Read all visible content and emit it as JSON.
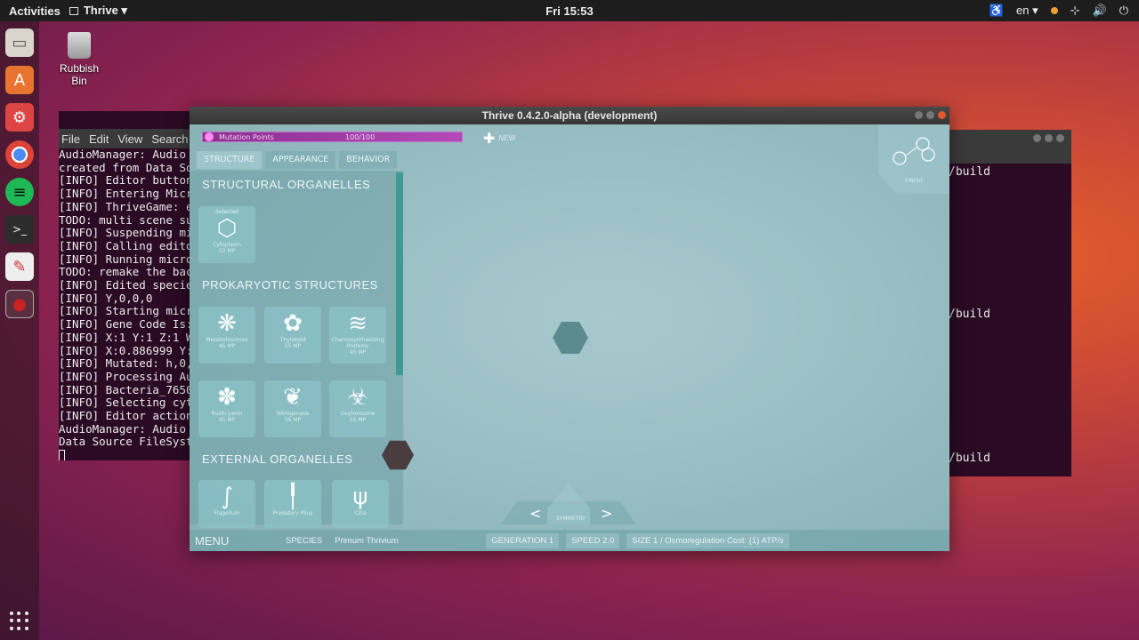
{
  "topbar": {
    "activities": "Activities",
    "app_name": "Thrive ▾",
    "clock": "Fri 15:53",
    "lang": "en ▾"
  },
  "desktop": {
    "bin_label": "Rubbish Bin"
  },
  "terminal_left": {
    "menu": [
      "File",
      "Edit",
      "View",
      "Search",
      "T"
    ],
    "lines": [
      "AudioManager: Audio",
      "created from Data So",
      "[INFO] Editor button",
      "[INFO] Entering Micr",
      "[INFO] ThriveGame: e",
      "TODO: multi scene su",
      "[INFO] Suspending mi",
      "[INFO] Calling edito",
      "[INFO] Running micro",
      "TODO: remake the bac",
      "[INFO] Edited specie",
      "[INFO] Y,0,0,0",
      "[INFO] Starting micr",
      "[INFO] Gene Code Is:",
      "[INFO] X:1 Y:1 Z:1 W",
      "[INFO] X:0.886999 Y:",
      "[INFO] Mutated: h,0,",
      "[INFO] Processing Au",
      "[INFO] Bacteria_7650",
      "[INFO] Selecting cyt",
      "[INFO] Editor action",
      "AudioManager: Audio",
      "Data Source FileSyst"
    ]
  },
  "terminal_right": {
    "lines": [
      "/build",
      "/build",
      "/build"
    ]
  },
  "thrive": {
    "title": "Thrive 0.4.2.0-alpha (development)",
    "mutation_points_label": "Mutation Points",
    "mutation_points_value": "100/100",
    "new_label": "NEW",
    "tabs": [
      "STRUCTURE",
      "APPEARANCE",
      "BEHAVIOR"
    ],
    "sections": [
      "STRUCTURAL ORGANELLES",
      "PROKARYOTIC STRUCTURES",
      "EXTERNAL ORGANELLES"
    ],
    "structural": [
      {
        "selected": "Selected",
        "name": "Cytoplasm",
        "cost": "22 MP",
        "icon": "⬡"
      }
    ],
    "prokaryotic": [
      {
        "name": "Metabolosomes",
        "cost": "45 MP",
        "icon": "❋"
      },
      {
        "name": "Thylakoid",
        "cost": "55 MP",
        "icon": "✿"
      },
      {
        "name": "Chemosynthesizing Proteins",
        "cost": "45 MP",
        "icon": "≋"
      },
      {
        "name": "Rusticyanin",
        "cost": "45 MP",
        "icon": "✽"
      },
      {
        "name": "Nitrogenase",
        "cost": "55 MP",
        "icon": "❦"
      },
      {
        "name": "Oxytoxisome",
        "cost": "55 MP",
        "icon": "☣"
      }
    ],
    "external": [
      {
        "name": "Flagellum",
        "icon": "∫"
      },
      {
        "name": "Predatory Pilus",
        "icon": "╿"
      },
      {
        "name": "Cilia",
        "icon": "ψ"
      }
    ],
    "finish_label": "FINISH",
    "symmetry_label": "SYMMETRY",
    "bottom": {
      "menu": "MENU",
      "species_label": "SPECIES",
      "species_name": "Primum Thrivium",
      "generation": "GENERATION  1",
      "speed": "SPEED  2.0",
      "size": "SIZE  1 / Osmoregulation Cost: (1) ATP/s"
    }
  }
}
